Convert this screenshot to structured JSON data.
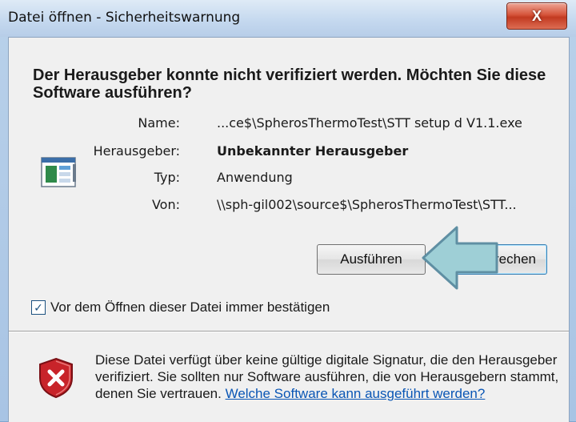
{
  "window": {
    "title": "Datei öffnen - Sicherheitswarnung",
    "close_label": "X"
  },
  "dialog": {
    "heading": "Der Herausgeber konnte nicht verifiziert werden. Möchten Sie diese Software ausführen?",
    "app_icon": "application-icon",
    "fields": [
      {
        "label": "Name:",
        "value": "...ce$\\SpherosThermoTest\\STT setup d V1.1.exe"
      },
      {
        "label": "Herausgeber:",
        "value": "Unbekannter Herausgeber"
      },
      {
        "label": "Typ:",
        "value": "Anwendung"
      },
      {
        "label": "Von:",
        "value": "\\\\sph-gil002\\source$\\SpherosThermoTest\\STT..."
      }
    ],
    "buttons": {
      "run_label": "Ausführen",
      "cancel_label": "rechen"
    },
    "callout_arrow": {
      "icon": "arrow-left-icon",
      "color": "#9ecfd6"
    },
    "checkbox": {
      "checked": true,
      "label": "Vor dem Öffnen dieser Datei immer bestätigen"
    },
    "warning": {
      "icon": "shield-error-icon",
      "text": "Diese Datei verfügt über keine gültige digitale Signatur, die den Herausgeber verifiziert. Sie sollten nur Software ausführen, die von Herausgebern stammt, denen Sie vertrauen.",
      "link": "Welche Software kann ausgeführt werden?"
    }
  },
  "colors": {
    "link": "#0a56b5",
    "close_button": "#c23a21"
  }
}
